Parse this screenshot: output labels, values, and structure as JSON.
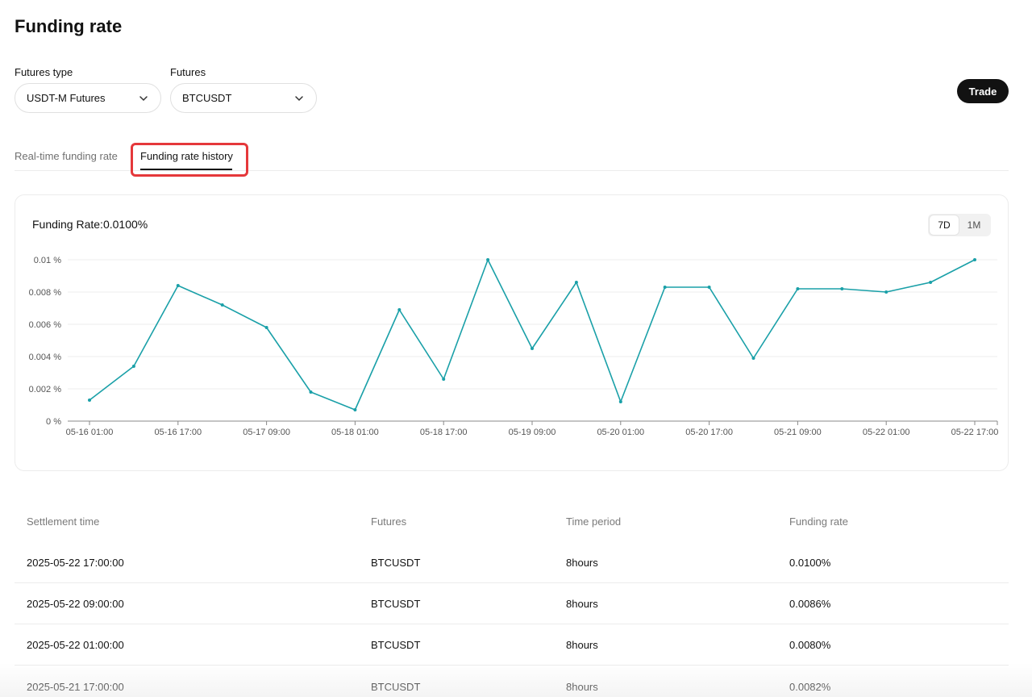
{
  "page": {
    "title": "Funding rate"
  },
  "filters": {
    "futures_type": {
      "label": "Futures type",
      "value": "USDT-M Futures"
    },
    "futures": {
      "label": "Futures",
      "value": "BTCUSDT"
    }
  },
  "actions": {
    "trade_label": "Trade"
  },
  "tabs": [
    {
      "label": "Real-time funding rate",
      "active": false
    },
    {
      "label": "Funding rate history",
      "active": true
    }
  ],
  "chart_panel": {
    "heading": "Funding Rate:0.0100%",
    "ranges": [
      {
        "label": "7D",
        "active": true
      },
      {
        "label": "1M",
        "active": false
      }
    ]
  },
  "chart_data": {
    "type": "line",
    "y_ticks": [
      0,
      0.002,
      0.004,
      0.006,
      0.008,
      0.01
    ],
    "y_tick_labels": [
      "0 %",
      "0.002 %",
      "0.004 %",
      "0.006 %",
      "0.008 %",
      "0.01 %"
    ],
    "ylim": [
      0,
      0.01
    ],
    "x_tick_labels": [
      "05-16 01:00",
      "05-16 17:00",
      "05-17 09:00",
      "05-18 01:00",
      "05-18 17:00",
      "05-19 09:00",
      "05-20 01:00",
      "05-20 17:00",
      "05-21 09:00",
      "05-22 01:00",
      "05-22 17:00"
    ],
    "x": [
      "05-16 01:00",
      "05-16 09:00",
      "05-16 17:00",
      "05-17 01:00",
      "05-17 09:00",
      "05-17 17:00",
      "05-18 01:00",
      "05-18 09:00",
      "05-18 17:00",
      "05-19 01:00",
      "05-19 09:00",
      "05-19 17:00",
      "05-20 01:00",
      "05-20 09:00",
      "05-20 17:00",
      "05-21 01:00",
      "05-21 09:00",
      "05-21 17:00",
      "05-22 01:00",
      "05-22 09:00",
      "05-22 17:00"
    ],
    "values": [
      0.0013,
      0.0034,
      0.0084,
      0.0072,
      0.0058,
      0.0018,
      0.0007,
      0.0069,
      0.0026,
      0.01,
      0.0045,
      0.0086,
      0.0012,
      0.0083,
      0.0083,
      0.0039,
      0.0082,
      0.0082,
      0.008,
      0.0086,
      0.01
    ],
    "grid": true,
    "line_color": "#1aa0a8"
  },
  "table": {
    "headers": [
      "Settlement time",
      "Futures",
      "Time period",
      "Funding rate"
    ],
    "rows": [
      [
        "2025-05-22 17:00:00",
        "BTCUSDT",
        "8hours",
        "0.0100%"
      ],
      [
        "2025-05-22 09:00:00",
        "BTCUSDT",
        "8hours",
        "0.0086%"
      ],
      [
        "2025-05-22 01:00:00",
        "BTCUSDT",
        "8hours",
        "0.0080%"
      ],
      [
        "2025-05-21 17:00:00",
        "BTCUSDT",
        "8hours",
        "0.0082%"
      ]
    ]
  },
  "colors": {
    "accent_line": "#1aa0a8",
    "highlight": "#e5383b",
    "primary_button": "#121212"
  }
}
